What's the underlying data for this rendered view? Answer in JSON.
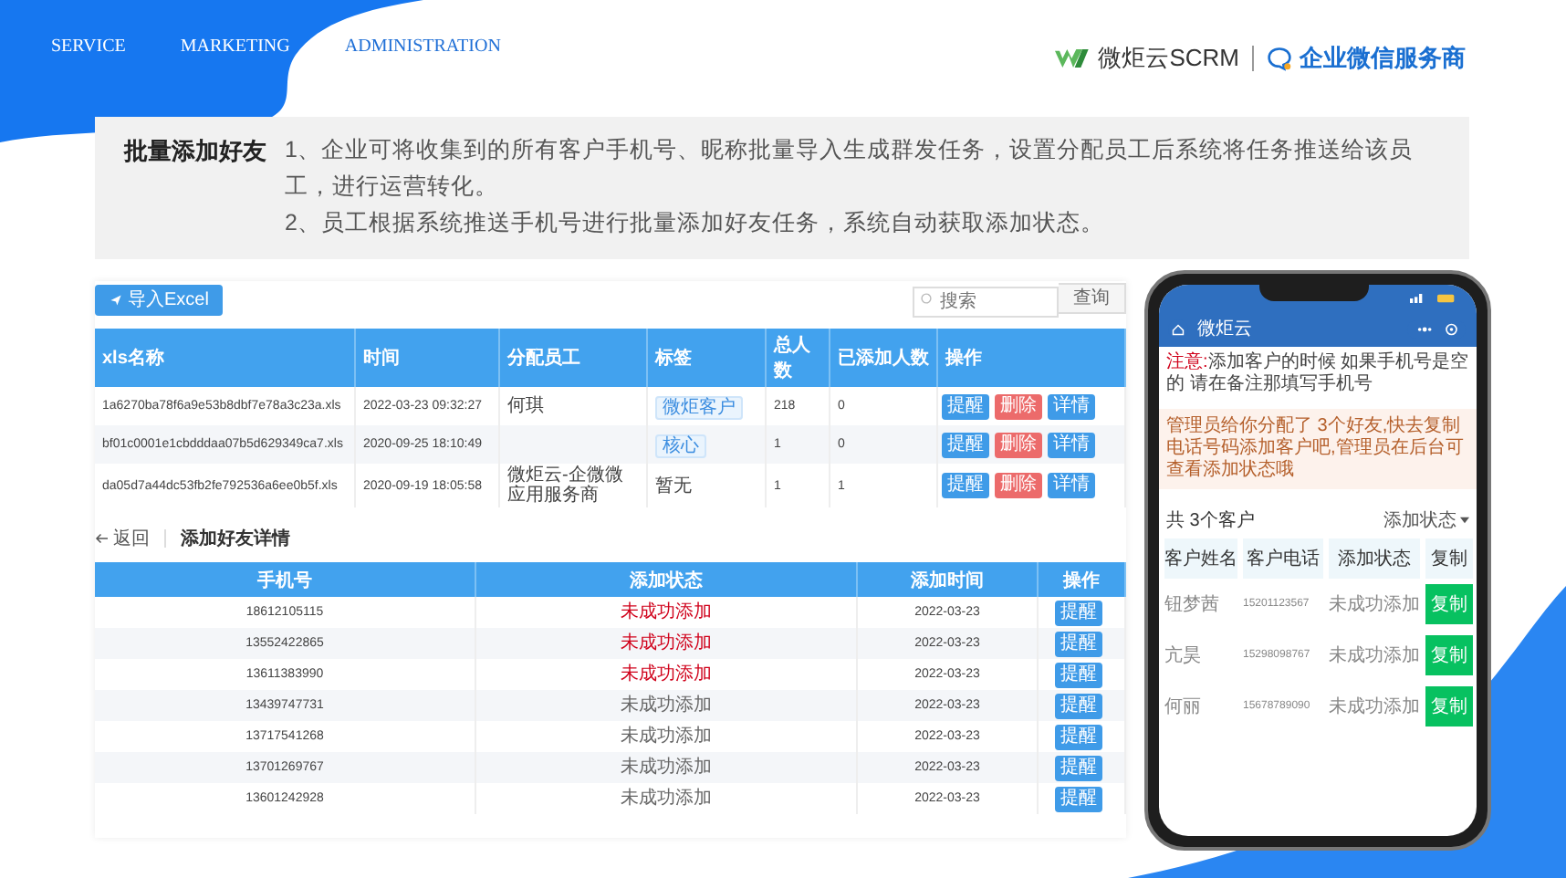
{
  "nav": [
    {
      "label": "SERVICE",
      "selected": false
    },
    {
      "label": "MARKETING",
      "selected": false
    },
    {
      "label": "ADMINISTRATION",
      "selected": true
    }
  ],
  "brand": {
    "name": "微炬云SCRM",
    "partner": "企业微信服务商"
  },
  "feature": {
    "title": "批量添加好友",
    "lines": [
      "1、企业可将收集到的所有客户手机号、昵称批量导入生成群发任务，设置分配员工后系统将任务推送给该员工，进行运营转化。",
      "2、员工根据系统推送手机号进行批量添加好友任务，系统自动获取添加状态。"
    ]
  },
  "toolbar": {
    "import_button": "导入Excel",
    "search": {
      "placeholder": "搜索"
    },
    "query_button": "查询"
  },
  "task_table": {
    "columns": [
      "xls名称",
      "时间",
      "分配员工",
      "标签",
      "总人数",
      "已添加人数",
      "操作"
    ],
    "rows": [
      {
        "file": "1a6270ba78f6a9e53b8dbf7e78a3c23a.xls",
        "time": "2022-03-23 09:32:27",
        "staff": "何琪",
        "label": {
          "text": "微炬客户",
          "kind": "chip"
        },
        "total": "218",
        "added": "0",
        "actions": [
          "提醒",
          "删除",
          "详情"
        ]
      },
      {
        "file": "bf01c0001e1cbdddaa07b5d629349ca7.xls",
        "time": "2020-09-25 18:10:49",
        "staff": "",
        "label": {
          "text": "核心",
          "kind": "chip"
        },
        "total": "1",
        "added": "0",
        "actions": [
          "提醒",
          "删除",
          "详情"
        ]
      },
      {
        "file": "da05d7a44dc53fb2fe792536a6ee0b5f.xls",
        "time": "2020-09-19 18:05:58",
        "staff": "微炬云-企微微应用服务商",
        "label": {
          "text": "暂无",
          "kind": "plain"
        },
        "total": "1",
        "added": "1",
        "actions": [
          "提醒",
          "删除",
          "详情"
        ]
      }
    ]
  },
  "detail": {
    "back": "返回",
    "title": "添加好友详情",
    "columns": [
      "手机号",
      "添加状态",
      "添加时间",
      "操作"
    ],
    "rows": [
      {
        "phone": "18612105115",
        "status": "未成功添加",
        "color": "#d0021b",
        "date": "2022-03-23",
        "action": "提醒"
      },
      {
        "phone": "13552422865",
        "status": "未成功添加",
        "color": "#d0021b",
        "date": "2022-03-23",
        "action": "提醒"
      },
      {
        "phone": "13611383990",
        "status": "未成功添加",
        "color": "#d0021b",
        "date": "2022-03-23",
        "action": "提醒"
      },
      {
        "phone": "13439747731",
        "status": "未成功添加",
        "color": "#666666",
        "date": "2022-03-23",
        "action": "提醒"
      },
      {
        "phone": "13717541268",
        "status": "未成功添加",
        "color": "#666666",
        "date": "2022-03-23",
        "action": "提醒"
      },
      {
        "phone": "13701269767",
        "status": "未成功添加",
        "color": "#666666",
        "date": "2022-03-23",
        "action": "提醒"
      },
      {
        "phone": "13601242928",
        "status": "未成功添加",
        "color": "#666666",
        "date": "2022-03-23",
        "action": "提醒"
      }
    ]
  },
  "phone": {
    "app_title": "微炬云",
    "notice_label": "注意:",
    "notice": "添加客户的时候 如果手机号是空的 请在备注那填写手机号",
    "message": "管理员给你分配了 3个好友,快去复制电话号码添加客户吧,管理员在后台可查看添加状态哦",
    "count": "共 3个客户",
    "filter": "添加状态",
    "columns": [
      "客户姓名",
      "客户电话",
      "添加状态",
      "复制"
    ],
    "rows": [
      {
        "name": "钮梦茜",
        "phone": "15201123567",
        "status": "未成功添加",
        "action": "复制"
      },
      {
        "name": "亢昊",
        "phone": "15298098767",
        "status": "未成功添加",
        "action": "复制"
      },
      {
        "name": "何丽",
        "phone": "15678789090",
        "status": "未成功添加",
        "action": "复制"
      }
    ]
  }
}
